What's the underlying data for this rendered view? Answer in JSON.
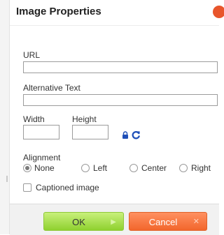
{
  "dialog": {
    "title": "Image Properties"
  },
  "fields": {
    "url_label": "URL",
    "url_value": "",
    "alt_label": "Alternative Text",
    "alt_value": "",
    "width_label": "Width",
    "width_value": "",
    "height_label": "Height",
    "height_value": ""
  },
  "alignment": {
    "label": "Alignment",
    "selected": "None",
    "options": [
      "None",
      "Left",
      "Center",
      "Right"
    ]
  },
  "caption": {
    "label": "Captioned image",
    "checked": false
  },
  "buttons": {
    "ok_label": "OK",
    "cancel_label": "Cancel"
  },
  "icons": {
    "close": "close-icon",
    "lock": "lock-icon",
    "reset": "reset-size-icon",
    "ok_arrow": "arrow-right-icon",
    "cancel_x": "x-icon"
  },
  "colors": {
    "ok_button": "#8fd12f",
    "cancel_button": "#f2662c",
    "close_button": "#e8552b",
    "icon_blue": "#1e4fb8"
  }
}
